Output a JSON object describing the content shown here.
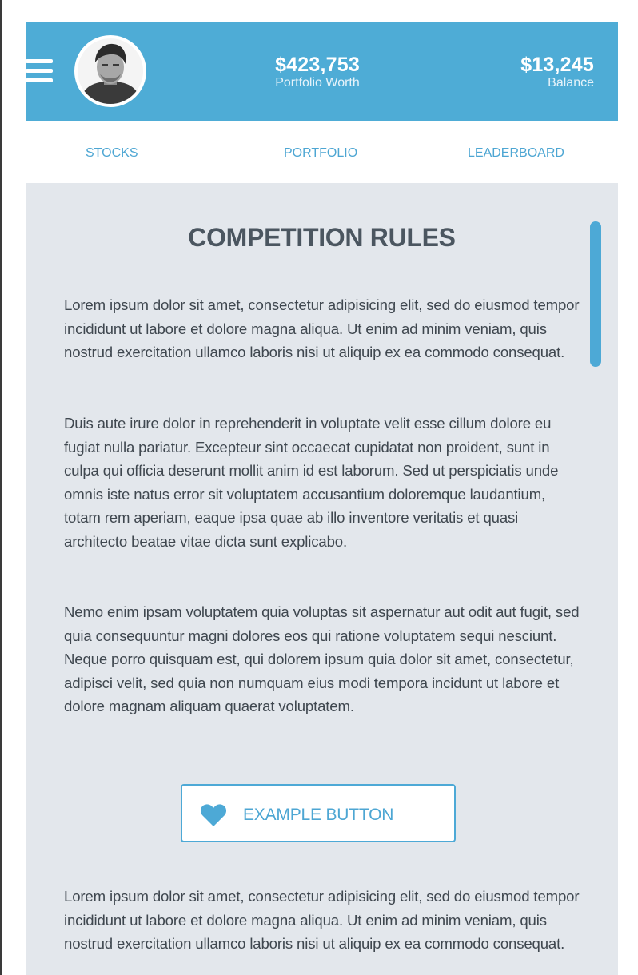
{
  "header": {
    "portfolio_value": "$423,753",
    "portfolio_label": "Portfolio Worth",
    "balance_value": "$13,245",
    "balance_label": "Balance"
  },
  "tabs": [
    {
      "label": "STOCKS"
    },
    {
      "label": "PORTFOLIO"
    },
    {
      "label": "LEADERBOARD"
    }
  ],
  "content": {
    "title": "COMPETITION RULES",
    "paragraphs": [
      "Lorem ipsum dolor sit amet, consectetur adipisicing elit, sed do eiusmod tempor incididunt ut labore et dolore magna aliqua. Ut enim ad minim veniam, quis nostrud exercitation ullamco laboris nisi ut aliquip ex ea commodo consequat.",
      "Duis aute irure dolor in reprehenderit in voluptate velit esse cillum dolore eu fugiat nulla pariatur. Excepteur sint occaecat cupidatat non proident, sunt in culpa qui officia deserunt mollit anim id est laborum. Sed ut perspiciatis unde omnis iste natus error sit voluptatem accusantium doloremque laudantium, totam rem aperiam, eaque ipsa quae ab illo inventore veritatis et quasi architecto beatae vitae dicta sunt explicabo.",
      "Nemo enim ipsam voluptatem quia voluptas sit aspernatur aut odit aut fugit, sed quia consequuntur magni dolores eos qui ratione voluptatem sequi nesciunt. Neque porro quisquam est, qui dolorem ipsum quia dolor sit amet, consectetur, adipisci velit, sed quia non numquam eius modi tempora incidunt ut labore et dolore magnam aliquam quaerat voluptatem.",
      "Lorem ipsum dolor sit amet, consectetur adipisicing elit, sed do eiusmod tempor incididunt ut labore et dolore magna aliqua. Ut enim ad minim veniam, quis nostrud exercitation ullamco laboris nisi ut aliquip ex ea commodo consequat."
    ],
    "button_label": "EXAMPLE BUTTON",
    "button_icon": "heart-icon",
    "menu_icon": "hamburger-menu-icon"
  },
  "colors": {
    "accent": "#4eacd6",
    "content_bg": "#e3e7ec",
    "text": "#3f474f",
    "title": "#4b5660"
  }
}
